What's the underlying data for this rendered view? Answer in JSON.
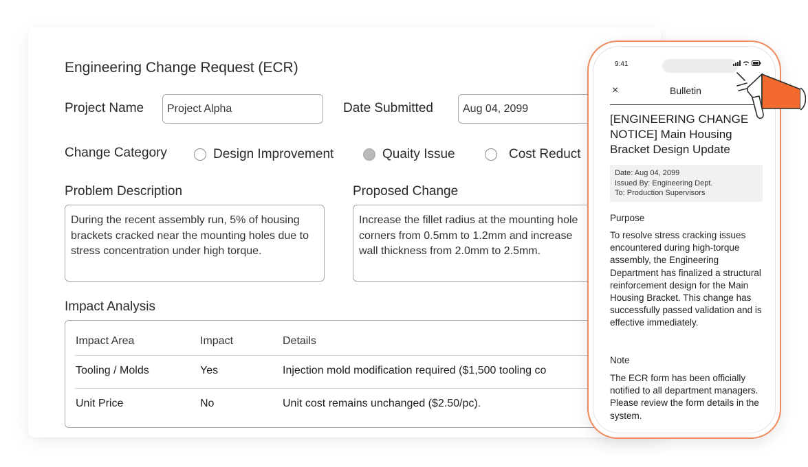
{
  "form": {
    "title": "Engineering Change Request (ECR)",
    "project_name_label": "Project Name",
    "project_name_value": "Project Alpha",
    "date_submitted_label": "Date Submitted",
    "date_submitted_value": "Aug 04, 2099",
    "change_category_label": "Change Category",
    "categories": [
      {
        "label": "Design Improvement",
        "selected": false
      },
      {
        "label": "Quaity Issue",
        "selected": true
      },
      {
        "label": "Cost Reduct",
        "selected": false
      }
    ],
    "problem_label": "Problem Description",
    "problem_text": "During the recent assembly run, 5% of housing brackets cracked near the mounting holes due to stress concentration under high torque.",
    "proposed_label": "Proposed Change",
    "proposed_text": "Increase the fillet radius at the mounting hole corners from 0.5mm to 1.2mm and increase wall thickness from 2.0mm to 2.5mm.",
    "impact_label": "Impact Analysis",
    "impact_table": {
      "headers": [
        "Impact Area",
        "Impact",
        "Details"
      ],
      "rows": [
        [
          "Tooling / Molds",
          "Yes",
          "Injection mold modification required ($1,500 tooling co"
        ],
        [
          "Unit Price",
          "No",
          "Unit cost remains unchanged ($2.50/pc)."
        ]
      ]
    }
  },
  "phone": {
    "time": "9:41",
    "header_title": "Bulletin",
    "close_glyph": "×",
    "notice_title": "[ENGINEERING CHANGE NOTICE] Main Housing Bracket Design Update",
    "meta": {
      "date": "Date: Aug 04, 2099",
      "issued_by": "Issued By: Engineering Dept.",
      "to": "To: Production Supervisors"
    },
    "purpose_heading": "Purpose",
    "purpose_text": "To resolve stress cracking issues encountered during high-torque assembly, the Engineering Department has finalized a structural reinforcement design for the Main Housing Bracket. This change has successfully passed validation and is effective immediately.",
    "note_heading": "Note",
    "note_text": "The ECR form has been officially notified to all department managers. Please review the form details in the system."
  },
  "colors": {
    "accent_orange": "#f26a2e",
    "phone_border": "#f08a5d",
    "radio_selected": "#b9b9b9"
  },
  "icons": [
    "close-icon",
    "signal-icon",
    "wifi-icon",
    "battery-icon",
    "megaphone-icon"
  ]
}
